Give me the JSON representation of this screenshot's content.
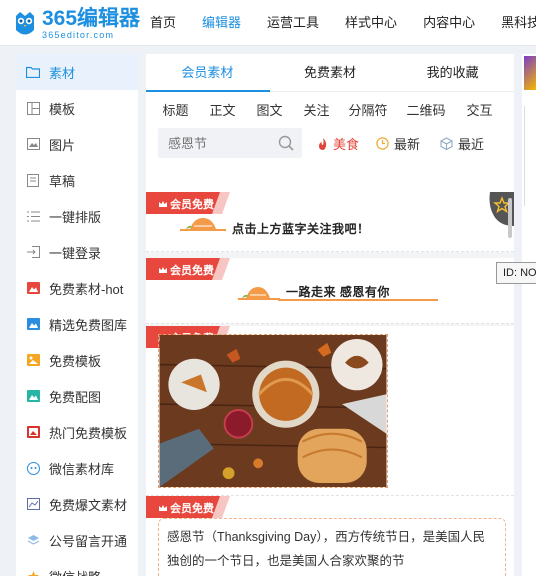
{
  "logo": {
    "main": "365编辑器",
    "sub": "365editor.com"
  },
  "nav": [
    {
      "label": "首页"
    },
    {
      "label": "编辑器"
    },
    {
      "label": "运营工具"
    },
    {
      "label": "样式中心"
    },
    {
      "label": "内容中心"
    },
    {
      "label": "黑科技盒"
    }
  ],
  "sidebar": {
    "items": [
      {
        "label": "素材",
        "icon": "folder-icon"
      },
      {
        "label": "模板",
        "icon": "layout-icon"
      },
      {
        "label": "图片",
        "icon": "image-icon"
      },
      {
        "label": "草稿",
        "icon": "draft-icon"
      },
      {
        "label": "一键排版",
        "icon": "list-icon"
      },
      {
        "label": "一键登录",
        "icon": "login-icon"
      },
      {
        "label": "免费素材-hot",
        "icon": "red-image-icon"
      },
      {
        "label": "精选免费图库",
        "icon": "blue-image-icon"
      },
      {
        "label": "免费模板",
        "icon": "orange-image-icon"
      },
      {
        "label": "免费配图",
        "icon": "teal-image-icon"
      },
      {
        "label": "热门免费模板",
        "icon": "red-gallery-icon"
      },
      {
        "label": "微信素材库",
        "icon": "wechat-icon"
      },
      {
        "label": "免费爆文素材",
        "icon": "chart-icon"
      },
      {
        "label": "公号留言开通",
        "icon": "layers-icon"
      },
      {
        "label": "微信战略",
        "icon": "star-icon"
      }
    ]
  },
  "tabs": [
    {
      "label": "会员素材"
    },
    {
      "label": "免费素材"
    },
    {
      "label": "我的收藏"
    }
  ],
  "categories": [
    "标题",
    "正文",
    "图文",
    "关注",
    "分隔符",
    "二维码",
    "交互"
  ],
  "search": {
    "placeholder": "感恩节"
  },
  "filters": [
    {
      "label": "美食",
      "color": "#e2453c"
    },
    {
      "label": "最新",
      "color": "#333333"
    },
    {
      "label": "最近",
      "color": "#333333"
    }
  ],
  "badge_label": "会员免费",
  "cards": [
    {
      "text": "点击上方蓝字关注我吧！"
    },
    {
      "text": "一路走来 感恩有你"
    },
    {
      "text": ""
    },
    {
      "text": "感恩节（Thanksgiving Day），西方传统节日，是美国人民独创的一个节日，也是美国人合家欢聚的节"
    }
  ],
  "tooltip": "ID: NO",
  "colors": {
    "accent": "#1d8fe0",
    "badge": "#e8473d",
    "orange": "#f39b48"
  }
}
